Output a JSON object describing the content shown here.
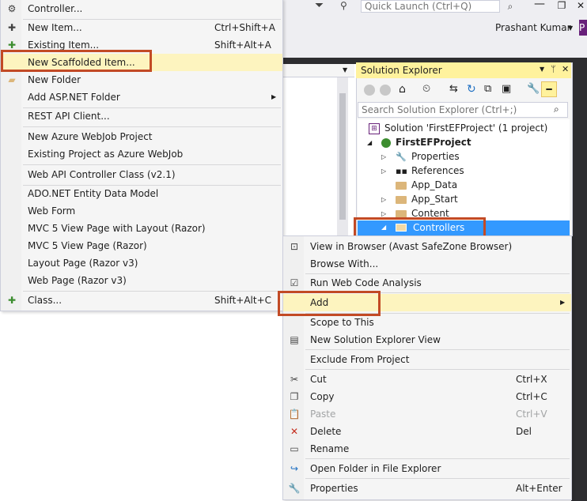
{
  "vs": {
    "quick_launch_placeholder": "Quick Launch (Ctrl+Q)",
    "user_name": "Prashant Kumar",
    "user_badge": "P"
  },
  "left_menu": {
    "items": [
      {
        "label": "Controller...",
        "shortcut": ""
      },
      {
        "label": "New Item...",
        "shortcut": "Ctrl+Shift+A"
      },
      {
        "label": "Existing Item...",
        "shortcut": "Shift+Alt+A"
      },
      {
        "label": "New Scaffolded Item...",
        "shortcut": ""
      },
      {
        "label": "New Folder",
        "shortcut": ""
      },
      {
        "label": "Add ASP.NET Folder",
        "shortcut": ""
      },
      {
        "label": "REST API Client...",
        "shortcut": ""
      },
      {
        "label": "New Azure WebJob Project",
        "shortcut": ""
      },
      {
        "label": "Existing Project as Azure WebJob",
        "shortcut": ""
      },
      {
        "label": "Web API Controller Class (v2.1)",
        "shortcut": ""
      },
      {
        "label": "ADO.NET Entity Data Model",
        "shortcut": ""
      },
      {
        "label": "Web Form",
        "shortcut": ""
      },
      {
        "label": "MVC 5 View Page with Layout (Razor)",
        "shortcut": ""
      },
      {
        "label": "MVC 5 View Page (Razor)",
        "shortcut": ""
      },
      {
        "label": "Layout Page (Razor v3)",
        "shortcut": ""
      },
      {
        "label": "Web Page (Razor v3)",
        "shortcut": ""
      },
      {
        "label": "Class...",
        "shortcut": "Shift+Alt+C"
      }
    ]
  },
  "solution_explorer": {
    "title": "Solution Explorer",
    "search_placeholder": "Search Solution Explorer (Ctrl+;)",
    "tree": [
      {
        "label": "Solution 'FirstEFProject' (1 project)"
      },
      {
        "label": "FirstEFProject"
      },
      {
        "label": "Properties"
      },
      {
        "label": "References"
      },
      {
        "label": "App_Data"
      },
      {
        "label": "App_Start"
      },
      {
        "label": "Content"
      },
      {
        "label": "Controllers"
      }
    ]
  },
  "context_menu": {
    "items": [
      {
        "label": "View in Browser (Avast SafeZone Browser)",
        "shortcut": ""
      },
      {
        "label": "Browse With...",
        "shortcut": ""
      },
      {
        "label": "Run Web Code Analysis",
        "shortcut": ""
      },
      {
        "label": "Add",
        "shortcut": ""
      },
      {
        "label": "Scope to This",
        "shortcut": ""
      },
      {
        "label": "New Solution Explorer View",
        "shortcut": ""
      },
      {
        "label": "Exclude From Project",
        "shortcut": ""
      },
      {
        "label": "Cut",
        "shortcut": "Ctrl+X"
      },
      {
        "label": "Copy",
        "shortcut": "Ctrl+C"
      },
      {
        "label": "Paste",
        "shortcut": "Ctrl+V"
      },
      {
        "label": "Delete",
        "shortcut": "Del"
      },
      {
        "label": "Rename",
        "shortcut": ""
      },
      {
        "label": "Open Folder in File Explorer",
        "shortcut": ""
      },
      {
        "label": "Properties",
        "shortcut": "Alt+Enter"
      }
    ]
  }
}
